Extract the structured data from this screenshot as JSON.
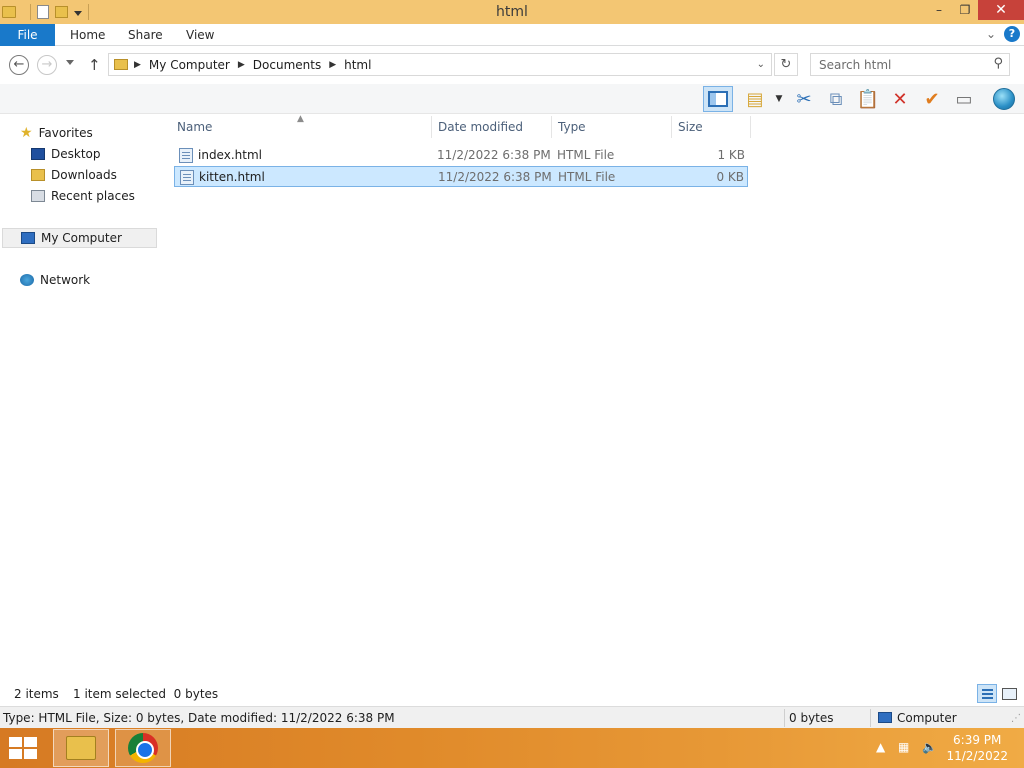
{
  "window": {
    "title": "html",
    "minimize": "–",
    "maximize": "❐",
    "close": "✕"
  },
  "ribbon": {
    "tabs": [
      "File",
      "Home",
      "Share",
      "View"
    ],
    "expand_icon": "chevron-down-icon",
    "help": "?"
  },
  "address_bar": {
    "breadcrumbs": [
      "My Computer",
      "Documents",
      "html"
    ],
    "search_placeholder": "Search html"
  },
  "sidebar": {
    "favorites_label": "Favorites",
    "favorites": [
      "Desktop",
      "Downloads",
      "Recent places"
    ],
    "my_computer": "My Computer",
    "network": "Network"
  },
  "file_list": {
    "columns": [
      "Name",
      "Date modified",
      "Type",
      "Size"
    ],
    "rows": [
      {
        "name": "index.html",
        "date": "11/2/2022 6:38 PM",
        "type": "HTML File",
        "size": "1 KB",
        "selected": false
      },
      {
        "name": "kitten.html",
        "date": "11/2/2022 6:38 PM",
        "type": "HTML File",
        "size": "0 KB",
        "selected": true
      }
    ]
  },
  "status": {
    "items_count": "2 items",
    "selected_info": "1 item selected  0 bytes"
  },
  "details": {
    "text": "Type: HTML File, Size: 0 bytes, Date modified: 11/2/2022 6:38 PM",
    "size": "0 bytes",
    "location": "Computer"
  },
  "taskbar": {
    "time": "6:39 PM",
    "date": "11/2/2022"
  },
  "colors": {
    "title_bar": "#f3c673",
    "file_tab": "#1979ca",
    "selection": "#cce8ff",
    "close_button": "#c7423a",
    "taskbar": "#e08a2a"
  }
}
